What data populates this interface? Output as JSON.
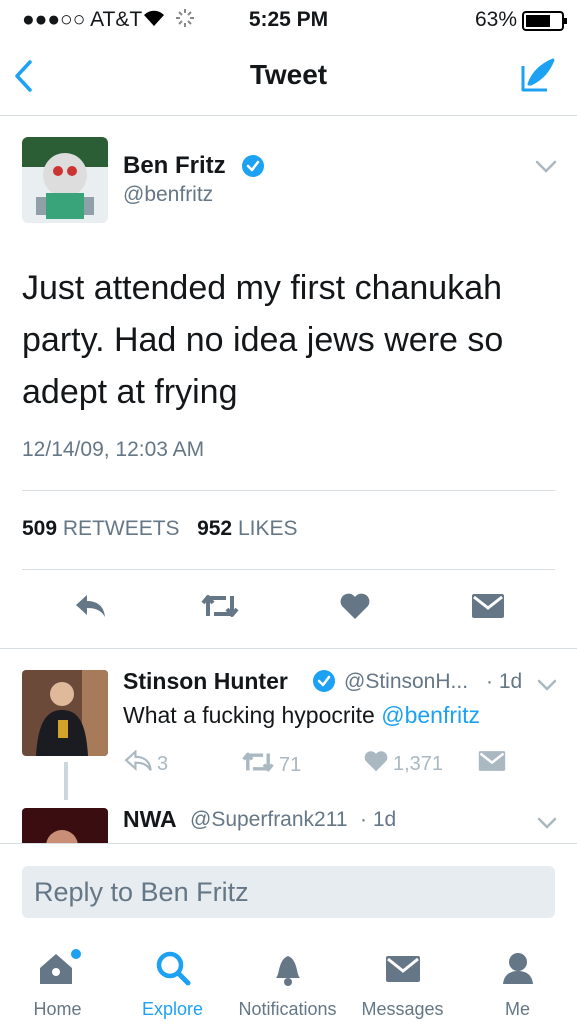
{
  "status_bar": {
    "carrier": "●●●○○ AT&T",
    "time": "5:25 PM",
    "battery": "63%"
  },
  "nav": {
    "title": "Tweet"
  },
  "tweet": {
    "author_name": "Ben Fritz",
    "author_handle": "@benfritz",
    "verified": true,
    "text": "Just attended my first chanukah party. Had no idea jews were so adept at frying",
    "timestamp": "12/14/09, 12:03 AM",
    "retweets_count": "509",
    "retweets_label": "RETWEETS",
    "likes_count": "952",
    "likes_label": "LIKES"
  },
  "replies": [
    {
      "name": "Stinson Hunter",
      "handle": "@StinsonH...",
      "age": "· 1d",
      "verified": true,
      "text": "What a fucking hypocrite ",
      "mention": "@benfritz",
      "reply_count": "3",
      "retweet_count": "71",
      "like_count": "1,371"
    },
    {
      "name": "NWA",
      "handle": "@Superfrank211",
      "age": "· 1d"
    }
  ],
  "composer": {
    "placeholder": "Reply to Ben Fritz"
  },
  "tabs": [
    {
      "label": "Home",
      "icon": "home-icon"
    },
    {
      "label": "Explore",
      "icon": "search-icon"
    },
    {
      "label": "Notifications",
      "icon": "bell-icon"
    },
    {
      "label": "Messages",
      "icon": "envelope-icon"
    },
    {
      "label": "Me",
      "icon": "person-icon"
    }
  ],
  "colors": {
    "accent": "#1da1f2",
    "muted": "#657786",
    "light": "#aab8c2",
    "icon": "#657786"
  }
}
